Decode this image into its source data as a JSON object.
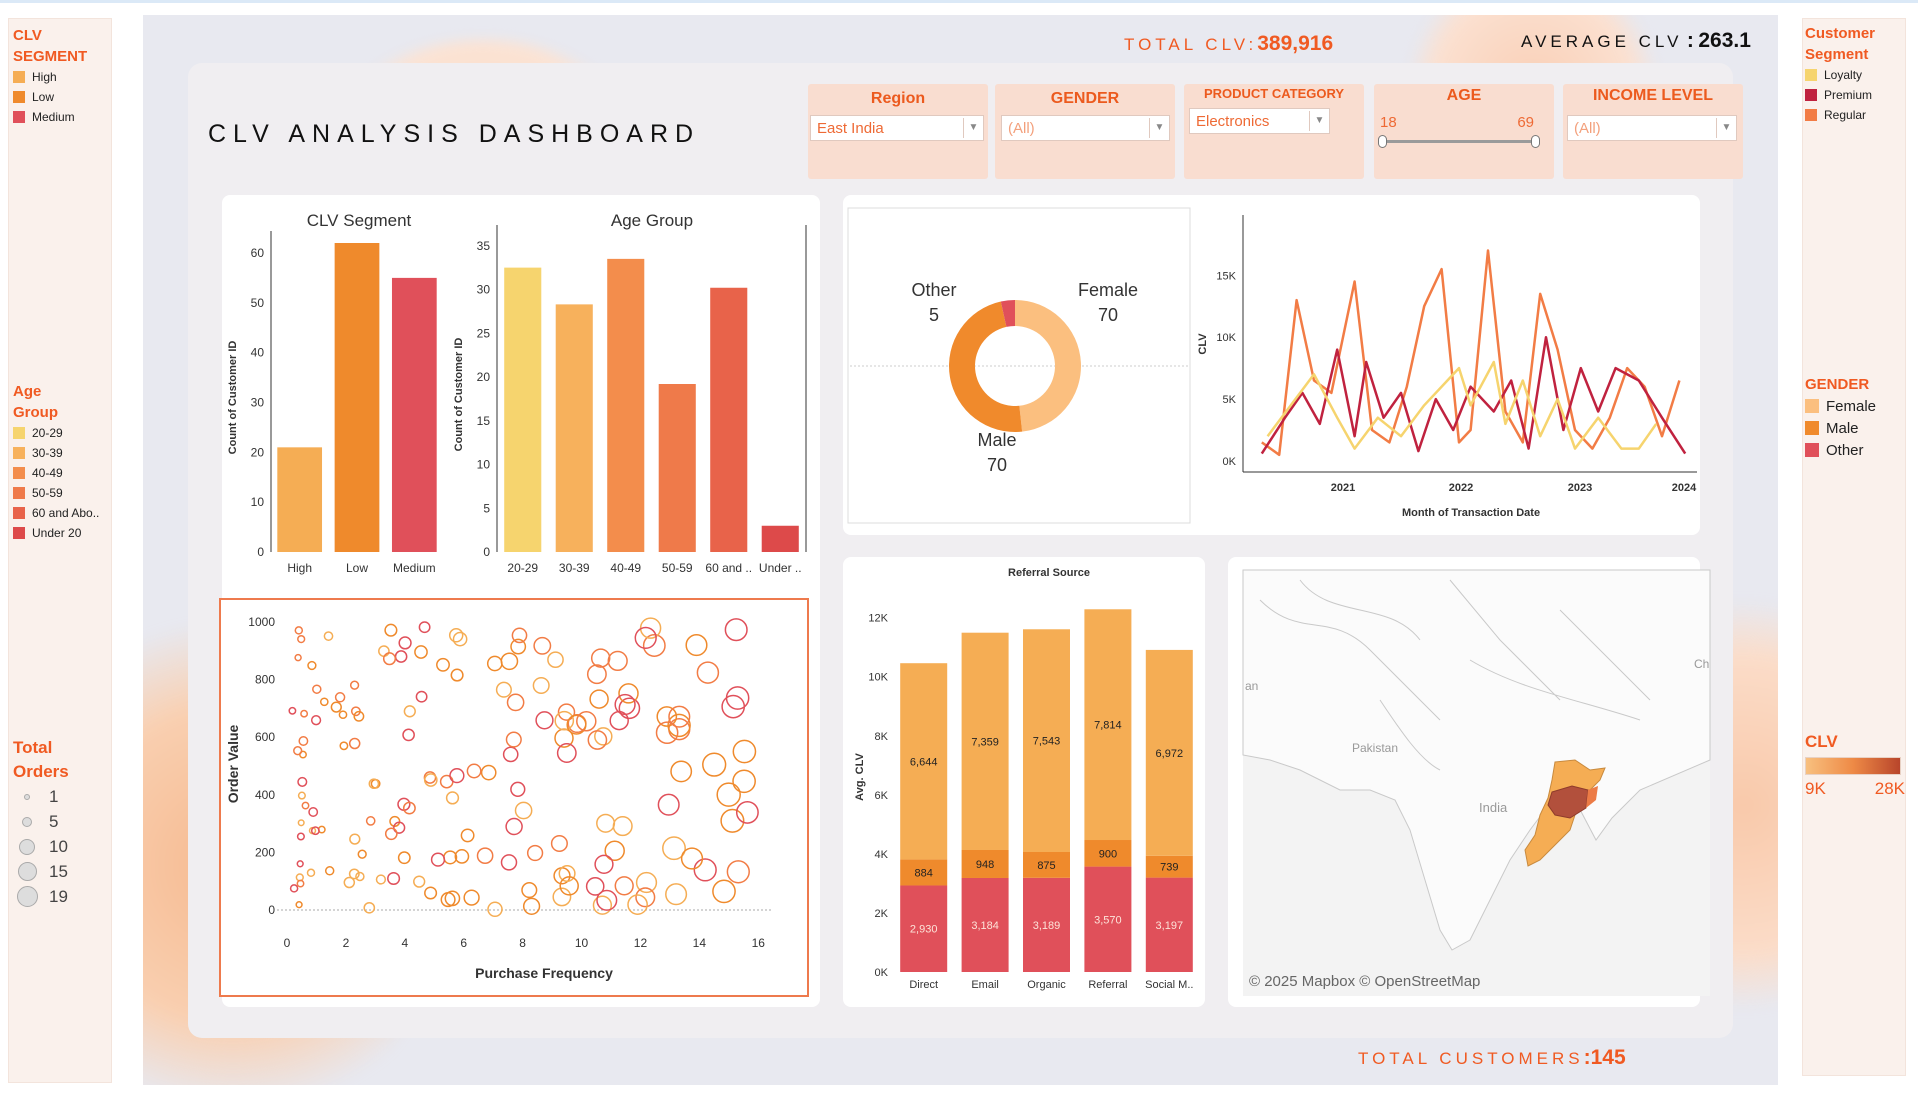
{
  "title": "CLV ANALYSIS DASHBOARD",
  "kpis": {
    "total_clv_label": "TOTAL CLV:",
    "total_clv_value": "389,916",
    "avg_clv_label": "AVERAGE CLV",
    "avg_clv_value": "263.1",
    "avg_clv_sep": ":",
    "total_customers_label": "TOTAL CUSTOMERS",
    "total_customers_value": ":145"
  },
  "filters": {
    "region": {
      "label": "Region",
      "value": "East India"
    },
    "gender": {
      "label": "GENDER",
      "value": "(All)"
    },
    "product": {
      "label": "PRODUCT CATEGORY",
      "value": "Electronics"
    },
    "age": {
      "label": "AGE",
      "min": "18",
      "max": "69"
    },
    "income": {
      "label": "INCOME LEVEL",
      "value": "(All)"
    }
  },
  "legends": {
    "clv_segment": {
      "title1": "CLV",
      "title2": "SEGMENT",
      "items": [
        {
          "label": "High",
          "color": "#f5ad54"
        },
        {
          "label": "Low",
          "color": "#ef8a2c"
        },
        {
          "label": "Medium",
          "color": "#e0505a"
        }
      ]
    },
    "age_group": {
      "title1": "Age",
      "title2": "Group",
      "items": [
        {
          "label": "20-29",
          "color": "#f6d46e"
        },
        {
          "label": "30-39",
          "color": "#f7b15c"
        },
        {
          "label": "40-49",
          "color": "#f38d4c"
        },
        {
          "label": "50-59",
          "color": "#ef7a4a"
        },
        {
          "label": "60 and Abo..",
          "color": "#e8634a"
        },
        {
          "label": "Under 20",
          "color": "#dd4a4a"
        }
      ]
    },
    "total_orders": {
      "title1": "Total",
      "title2": "Orders",
      "items": [
        "1",
        "5",
        "10",
        "15",
        "19"
      ]
    },
    "customer_segment": {
      "title1": "Customer",
      "title2": "Segment",
      "items": [
        {
          "label": "Loyalty",
          "color": "#f6d46e"
        },
        {
          "label": "Premium",
          "color": "#c0223f"
        },
        {
          "label": "Regular",
          "color": "#f27c45"
        }
      ]
    },
    "gender": {
      "title": "GENDER",
      "items": [
        {
          "label": "Female",
          "color": "#fbbf7f"
        },
        {
          "label": "Male",
          "color": "#f08a2c"
        },
        {
          "label": "Other",
          "color": "#e0505a"
        }
      ]
    },
    "clv": {
      "title": "CLV",
      "min": "9K",
      "max": "28K"
    }
  },
  "map": {
    "attribution": "© 2025 Mapbox © OpenStreetMap",
    "labels": [
      "Iran",
      "Pakistan",
      "India",
      "Ch"
    ]
  },
  "chart_data": [
    {
      "type": "bar",
      "title": "CLV Segment",
      "categories": [
        "High",
        "Low",
        "Medium"
      ],
      "values": [
        21,
        62,
        55
      ],
      "ylabel": "Count of Customer ID",
      "ylim": [
        0,
        62
      ],
      "yticks": [
        0,
        10,
        20,
        30,
        40,
        50,
        60
      ],
      "colors": [
        "#f5ad54",
        "#ef8a2c",
        "#e0505a"
      ]
    },
    {
      "type": "bar",
      "title": "Age Group",
      "categories": [
        "20-29",
        "30-39",
        "40-49",
        "50-59",
        "60 and ..",
        "Under .."
      ],
      "values": [
        32.5,
        28.3,
        33.5,
        19.2,
        30.2,
        3
      ],
      "ylabel": "Count of Customer ID",
      "ylim": [
        0,
        36
      ],
      "yticks": [
        0,
        5,
        10,
        15,
        20,
        25,
        30,
        35
      ],
      "colors": [
        "#f6d46e",
        "#f7b15c",
        "#f38d4c",
        "#ef7a4a",
        "#e8634a",
        "#dd4a4a"
      ]
    },
    {
      "type": "pie",
      "title": "",
      "slices": [
        {
          "name": "Female",
          "value": 70,
          "color": "#fbbf7f"
        },
        {
          "name": "Male",
          "value": 70,
          "color": "#f08a2c"
        },
        {
          "name": "Other",
          "value": 5,
          "color": "#e0505a"
        }
      ]
    },
    {
      "type": "line",
      "title": "",
      "xlabel": "Month of Transaction Date",
      "ylabel": "CLV",
      "xticks": [
        "2021",
        "2022",
        "2023",
        "2024"
      ],
      "yticks": [
        "0K",
        "5K",
        "10K",
        "15K"
      ],
      "ylim": [
        0,
        17500
      ],
      "series": [
        {
          "name": "Regular",
          "color": "#f27c45",
          "points": [
            [
              2020.3,
              1500
            ],
            [
              2020.45,
              500
            ],
            [
              2020.6,
              13000
            ],
            [
              2020.75,
              6500
            ],
            [
              2020.9,
              5500
            ],
            [
              2021.1,
              14500
            ],
            [
              2021.25,
              2500
            ],
            [
              2021.4,
              1500
            ],
            [
              2021.55,
              6000
            ],
            [
              2021.7,
              12500
            ],
            [
              2021.85,
              15500
            ],
            [
              2022.0,
              1500
            ],
            [
              2022.1,
              2500
            ],
            [
              2022.25,
              17000
            ],
            [
              2022.4,
              4000
            ],
            [
              2022.55,
              1500
            ],
            [
              2022.7,
              13500
            ],
            [
              2022.85,
              9000
            ],
            [
              2023.0,
              2500
            ],
            [
              2023.15,
              1000
            ],
            [
              2023.3,
              3500
            ],
            [
              2023.45,
              7500
            ],
            [
              2023.6,
              6000
            ],
            [
              2023.75,
              2000
            ],
            [
              2023.9,
              6500
            ]
          ]
        },
        {
          "name": "Premium",
          "color": "#c0223f",
          "points": [
            [
              2020.3,
              600
            ],
            [
              2020.5,
              3500
            ],
            [
              2020.65,
              5500
            ],
            [
              2020.8,
              3000
            ],
            [
              2020.95,
              9000
            ],
            [
              2021.1,
              2000
            ],
            [
              2021.2,
              8000
            ],
            [
              2021.35,
              3500
            ],
            [
              2021.5,
              5500
            ],
            [
              2021.65,
              800
            ],
            [
              2021.8,
              5000
            ],
            [
              2021.95,
              2500
            ],
            [
              2022.1,
              6000
            ],
            [
              2022.3,
              4000
            ],
            [
              2022.45,
              6500
            ],
            [
              2022.6,
              1000
            ],
            [
              2022.75,
              10000
            ],
            [
              2022.9,
              2500
            ],
            [
              2023.05,
              7500
            ],
            [
              2023.2,
              4000
            ],
            [
              2023.35,
              7500
            ],
            [
              2023.55,
              6500
            ],
            [
              2023.75,
              3500
            ],
            [
              2023.95,
              600
            ]
          ]
        },
        {
          "name": "Loyalty",
          "color": "#f6d46e",
          "points": [
            [
              2020.35,
              2000
            ],
            [
              2020.55,
              4500
            ],
            [
              2020.75,
              7000
            ],
            [
              2020.95,
              3500
            ],
            [
              2021.1,
              1000
            ],
            [
              2021.3,
              3500
            ],
            [
              2021.5,
              2000
            ],
            [
              2021.7,
              4500
            ],
            [
              2021.9,
              6500
            ],
            [
              2022.0,
              7500
            ],
            [
              2022.1,
              4500
            ],
            [
              2022.3,
              8000
            ],
            [
              2022.4,
              3000
            ],
            [
              2022.55,
              6500
            ],
            [
              2022.7,
              2000
            ],
            [
              2022.85,
              5000
            ],
            [
              2023.0,
              1000
            ],
            [
              2023.2,
              3500
            ],
            [
              2023.4,
              1000
            ],
            [
              2023.55,
              1000
            ],
            [
              2023.7,
              3000
            ]
          ]
        }
      ]
    },
    {
      "type": "scatter",
      "title": "",
      "xlabel": "Purchase Frequency",
      "ylabel": "Order Value",
      "xticks": [
        0,
        2,
        4,
        6,
        8,
        10,
        12,
        14,
        16
      ],
      "yticks": [
        0,
        200,
        400,
        600,
        800,
        1000
      ],
      "xlim": [
        0,
        16.5
      ],
      "ylim": [
        0,
        1000
      ]
    },
    {
      "type": "bar",
      "title": "Referral Source",
      "ylabel": "Avg. CLV",
      "categories": [
        "Direct",
        "Email",
        "Organic",
        "Referral",
        "Social M.."
      ],
      "yticks": [
        "0K",
        "2K",
        "4K",
        "6K",
        "8K",
        "10K",
        "12K"
      ],
      "ylim": [
        0,
        12700
      ],
      "series": [
        {
          "name": "Medium",
          "color": "#e0505a",
          "values": [
            2930,
            3184,
            3189,
            3570,
            3197
          ]
        },
        {
          "name": "Low",
          "color": "#ef8a2c",
          "values": [
            884,
            948,
            875,
            900,
            739
          ]
        },
        {
          "name": "High",
          "color": "#f5ad54",
          "values": [
            6644,
            7359,
            7543,
            7814,
            6972
          ]
        }
      ]
    }
  ]
}
